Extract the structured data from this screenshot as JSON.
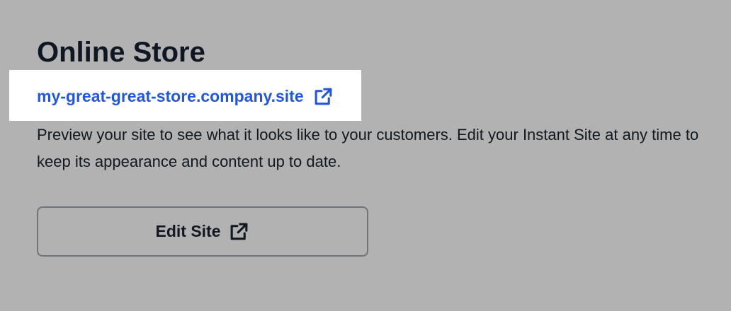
{
  "store": {
    "title": "Online Store",
    "site_url": "my-great-great-store.company.site",
    "description": "Preview your site to see what it looks like to your customers. Edit your Instant Site at any time to keep its appearance and content up to date.",
    "edit_button_label": "Edit Site"
  },
  "icons": {
    "url_icon": "external-link-icon",
    "edit_icon": "external-link-icon"
  },
  "colors": {
    "background": "#b2b2b2",
    "highlight": "#ffffff",
    "link": "#2457d6",
    "text": "#101820",
    "button_border": "#6f747a"
  }
}
